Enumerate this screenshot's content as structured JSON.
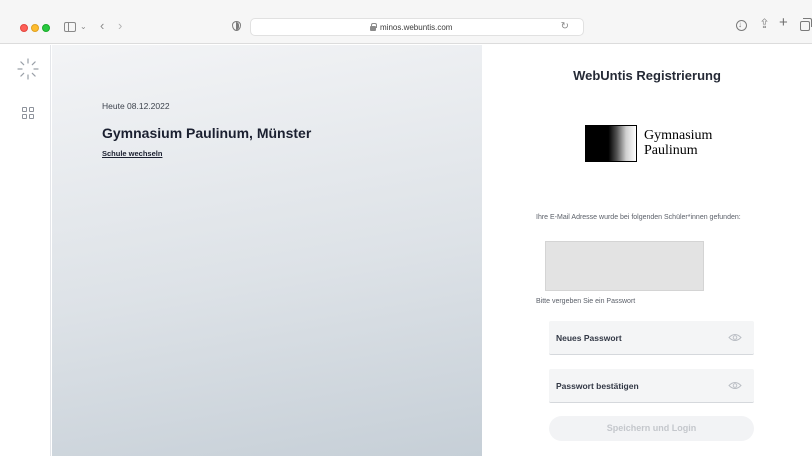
{
  "browser": {
    "url": "minos.webuntis.com",
    "colors": {
      "close": "#fe5f57",
      "minimize": "#febc2e",
      "zoom": "#28c840"
    }
  },
  "page": {
    "date": "Heute 08.12.2022",
    "school_name": "Gymnasium Paulinum, Münster",
    "change_school": "Schule wechseln",
    "title": "WebUntis Registrierung",
    "logo": {
      "line1": "Gymnasium",
      "line2": "Paulinum"
    },
    "email_info": "Ihre E-Mail Adresse wurde bei folgenden Schüler*innen gefunden:",
    "password_hint": "Bitte vergeben Sie ein Passwort",
    "new_password_placeholder": "Neues Passwort",
    "confirm_password_placeholder": "Passwort bestätigen",
    "submit_label": "Speichern und Login"
  },
  "icons": {
    "rail": [
      "loading-spinner-icon",
      "dashboard-grid-icon"
    ],
    "toolbar": [
      "sidebar-toggle-icon",
      "back-icon",
      "forward-icon",
      "shield-icon",
      "lock-icon",
      "reload-icon",
      "download-icon",
      "share-icon",
      "new-tab-icon",
      "tab-overview-icon"
    ]
  }
}
